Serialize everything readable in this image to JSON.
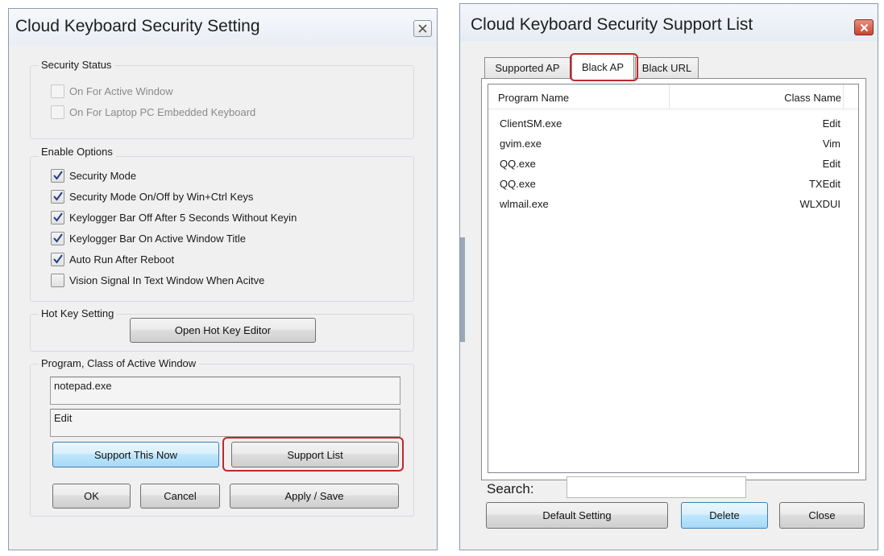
{
  "settings": {
    "title": "Cloud Keyboard Security Setting",
    "security_status": {
      "label": "Security Status",
      "options": [
        {
          "label": "On For Active Window",
          "checked": false,
          "disabled": true
        },
        {
          "label": "On For Laptop PC Embedded Keyboard",
          "checked": false,
          "disabled": true
        }
      ]
    },
    "enable_options": {
      "label": "Enable Options",
      "options": [
        {
          "label": "Security Mode",
          "checked": true
        },
        {
          "label": "Security Mode On/Off by Win+Ctrl Keys",
          "checked": true
        },
        {
          "label": "Keylogger Bar Off After 5 Seconds Without Keyin",
          "checked": true
        },
        {
          "label": "Keylogger Bar On Active Window Title",
          "checked": true
        },
        {
          "label": "Auto Run After Reboot",
          "checked": true
        },
        {
          "label": "Vision Signal In Text Window When Acitve",
          "checked": false
        }
      ]
    },
    "hotkey": {
      "label": "Hot Key Setting",
      "button": "Open Hot Key Editor"
    },
    "program": {
      "label": "Program, Class of Active Window",
      "program_value": "notepad.exe",
      "class_value": "Edit",
      "support_now": "Support This Now",
      "support_list": "Support List"
    },
    "buttons": {
      "ok": "OK",
      "cancel": "Cancel",
      "apply": "Apply / Save"
    }
  },
  "support": {
    "title": "Cloud Keyboard Security Support List",
    "tabs": [
      {
        "label": "Supported AP",
        "active": false
      },
      {
        "label": "Black AP",
        "active": true
      },
      {
        "label": "Black URL",
        "active": false
      }
    ],
    "columns": {
      "program": "Program Name",
      "class": "Class Name"
    },
    "rows": [
      {
        "program": "ClientSM.exe",
        "class": "Edit"
      },
      {
        "program": "gvim.exe",
        "class": "Vim"
      },
      {
        "program": "QQ.exe",
        "class": "Edit"
      },
      {
        "program": "QQ.exe",
        "class": "TXEdit"
      },
      {
        "program": "wlmail.exe",
        "class": "WLXDUI"
      }
    ],
    "search_label": "Search:",
    "search_value": "",
    "buttons": {
      "default": "Default Setting",
      "delete": "Delete",
      "close": "Close"
    }
  },
  "colors": {
    "highlight": "#c0282b",
    "close_red": "#c8452f"
  }
}
